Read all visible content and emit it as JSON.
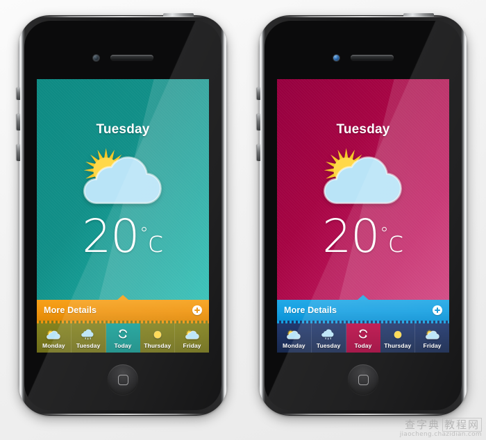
{
  "scene": {
    "background_color": "#f3f3f3",
    "phone_count": 2
  },
  "watermark": {
    "cn_text": "查字典",
    "cn_boxed": "教程网",
    "url": "jiaocheng.chazidian.com"
  },
  "phones": [
    {
      "name": "teal-theme-phone",
      "theme": {
        "screen_bg": "#0d8a83",
        "accent_bar": "#f0950f",
        "strip_bg": "#7b7b1f",
        "active_cell": "#17a098"
      },
      "screen": {
        "day_title": "Tuesday",
        "condition_icon": "sun-behind-cloud-icon",
        "temp_value": "20",
        "temp_degree": "°",
        "temp_unit": "c",
        "details_label": "More Details",
        "details_action_icon": "plus-circle-icon"
      },
      "days": [
        {
          "label": "Monday",
          "icon": "sun-behind-cloud-icon",
          "active": false
        },
        {
          "label": "Tuesday",
          "icon": "rain-cloud-icon",
          "active": false
        },
        {
          "label": "Today",
          "icon": "refresh-icon",
          "active": true
        },
        {
          "label": "Thursday",
          "icon": "sun-icon",
          "active": false
        },
        {
          "label": "Friday",
          "icon": "sun-behind-cloud-icon",
          "active": false
        }
      ]
    },
    {
      "name": "crimson-theme-phone",
      "theme": {
        "screen_bg": "#a60443",
        "accent_bar": "#16a0e2",
        "strip_bg": "#1d3468",
        "active_cell": "#ba0b46"
      },
      "screen": {
        "day_title": "Tuesday",
        "condition_icon": "sun-behind-cloud-icon",
        "temp_value": "20",
        "temp_degree": "°",
        "temp_unit": "c",
        "details_label": "More Details",
        "details_action_icon": "plus-circle-icon"
      },
      "days": [
        {
          "label": "Monday",
          "icon": "sun-behind-cloud-icon",
          "active": false
        },
        {
          "label": "Tuesday",
          "icon": "rain-cloud-icon",
          "active": false
        },
        {
          "label": "Today",
          "icon": "refresh-icon",
          "active": true
        },
        {
          "label": "Thursday",
          "icon": "sun-icon",
          "active": false
        },
        {
          "label": "Friday",
          "icon": "sun-behind-cloud-icon",
          "active": false
        }
      ]
    }
  ]
}
